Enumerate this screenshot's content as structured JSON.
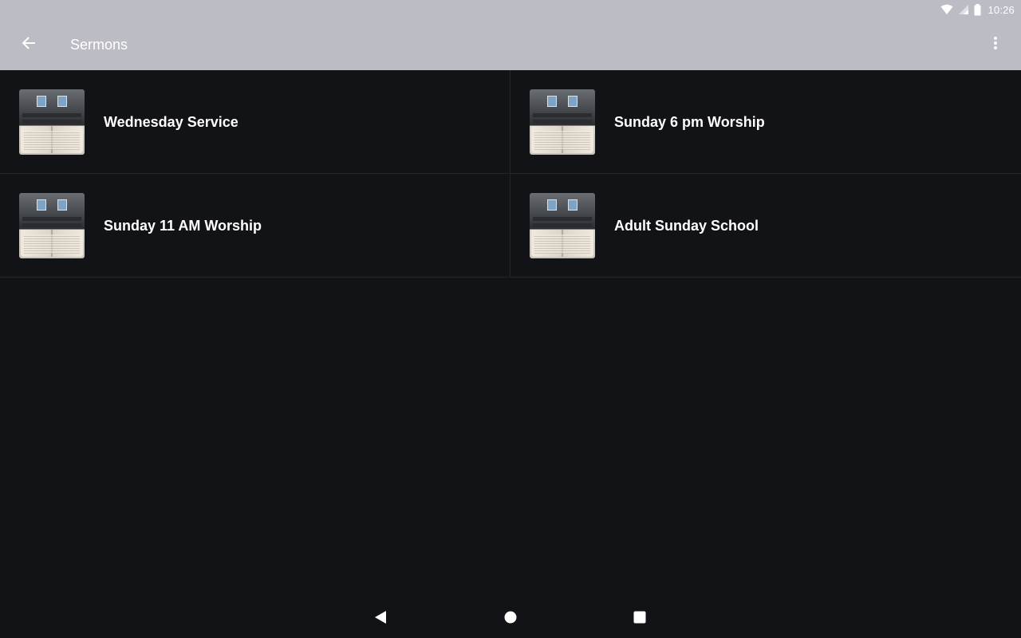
{
  "status_bar": {
    "time": "10:26",
    "icons": [
      "wifi-icon",
      "cell-signal-icon",
      "battery-icon"
    ]
  },
  "app_bar": {
    "back_icon": "arrow-back-icon",
    "title": "Sermons",
    "overflow_icon": "more-vert-icon",
    "background": "#bcbcc4"
  },
  "sermons": {
    "items": [
      {
        "label": "Wednesday Service",
        "thumbnail": "church-bible-thumbnail"
      },
      {
        "label": "Sunday 6 pm Worship",
        "thumbnail": "church-bible-thumbnail"
      },
      {
        "label": "Sunday 11 AM Worship",
        "thumbnail": "church-bible-thumbnail"
      },
      {
        "label": "Adult Sunday School",
        "thumbnail": "church-bible-thumbnail"
      }
    ]
  },
  "nav_bar": {
    "icons": [
      "nav-back-icon",
      "nav-home-icon",
      "nav-recents-icon"
    ]
  },
  "colors": {
    "background": "#121316",
    "divider": "#24252a",
    "text": "#ffffff"
  }
}
